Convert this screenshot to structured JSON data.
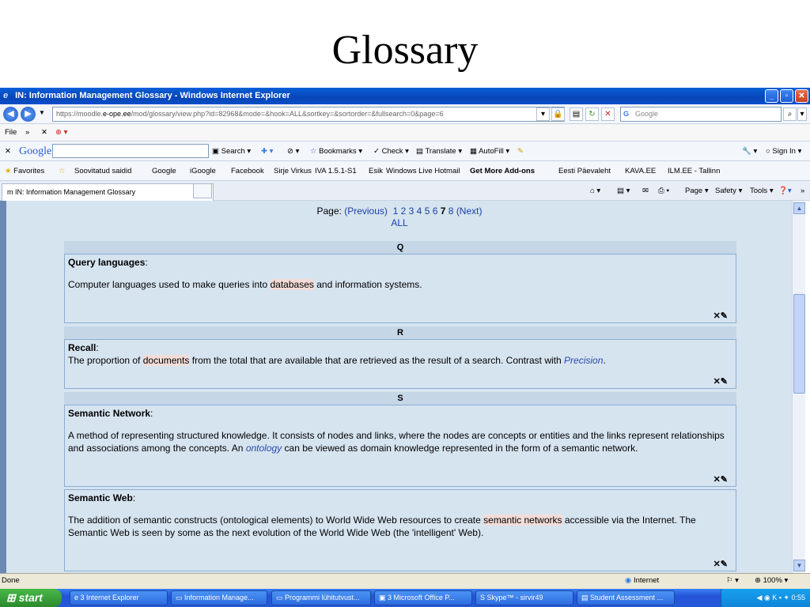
{
  "slide": {
    "title": "Glossary"
  },
  "window": {
    "title": "IN: Information Management Glossary - Windows Internet Explorer"
  },
  "address": {
    "prefix": "https://moodle.",
    "domain": "e-ope.ee",
    "path": "/mod/glossary/view.php?id=82968&mode=&hook=ALL&sortkey=&sortorder=&fullsearch=0&page=6",
    "search_placeholder": "Google"
  },
  "menu": {
    "file": "File"
  },
  "google_bar": {
    "logo": "Google",
    "search_label": "Search",
    "bookmarks_label": "Bookmarks",
    "check_label": "Check",
    "translate_label": "Translate",
    "autofill_label": "AutoFill",
    "signin_label": "Sign In"
  },
  "favorites": {
    "label": "Favorites",
    "items": [
      "Soovitatud saidid",
      "Google",
      "iGoogle",
      "Facebook",
      "Sirje Virkus",
      "IVA 1.5.1-S1",
      "Esik",
      "Windows Live Hotmail",
      "Get More Add-ons",
      "Eesti Päevaleht",
      "KAVA.EE",
      "ILM.EE - Tallinn"
    ]
  },
  "tab": {
    "label": "IN: Information Management Glossary"
  },
  "commandbar": {
    "page": "Page",
    "safety": "Safety",
    "tools": "Tools"
  },
  "pager": {
    "label": "Page:",
    "previous": "(Previous)",
    "pages": [
      "1",
      "2",
      "3",
      "4",
      "5",
      "6"
    ],
    "current": "7",
    "last": "8",
    "next": "(Next)",
    "all": "ALL"
  },
  "sections": [
    {
      "letter": "Q"
    },
    {
      "letter": "R"
    },
    {
      "letter": "S"
    }
  ],
  "entries": [
    {
      "term": "Query languages",
      "def": [
        "Computer languages used to make queries into ",
        "databases",
        " and information systems."
      ]
    },
    {
      "term": "Recall",
      "def_a": "The proportion of ",
      "def_hl": "documents",
      "def_b": " from the total that are available that are retrieved as the result of a search. Contrast with ",
      "def_link": "Precision",
      "def_c": "."
    },
    {
      "term": "Semantic Network",
      "def_a": "A method of representing structured knowledge. It consists of nodes and links, where the nodes are concepts or entities and the links represent relationships and associations among the concepts. An ",
      "def_link": "ontology",
      "def_b": " can be viewed as domain knowledge represented in the form of a semantic network."
    },
    {
      "term": "Semantic Web",
      "def_a": "The addition of semantic constructs (ontological elements) to World Wide Web resources to create ",
      "def_hl": "semantic networks",
      "def_b": " accessible via the Internet. The Semantic Web is seen by some as the next evolution of the World Wide Web (the 'intelligent' Web)."
    }
  ],
  "status": {
    "left": "Done",
    "zone": "Internet",
    "zoom": "100%"
  },
  "taskbar": {
    "start": "start",
    "tasks": [
      "3 Internet Explorer",
      "Information Manage...",
      "Programmi lühitutvust...",
      "3 Microsoft Office P...",
      "Skype™ - sirvir49",
      "Student Assessment ..."
    ],
    "clock": "0:55"
  }
}
